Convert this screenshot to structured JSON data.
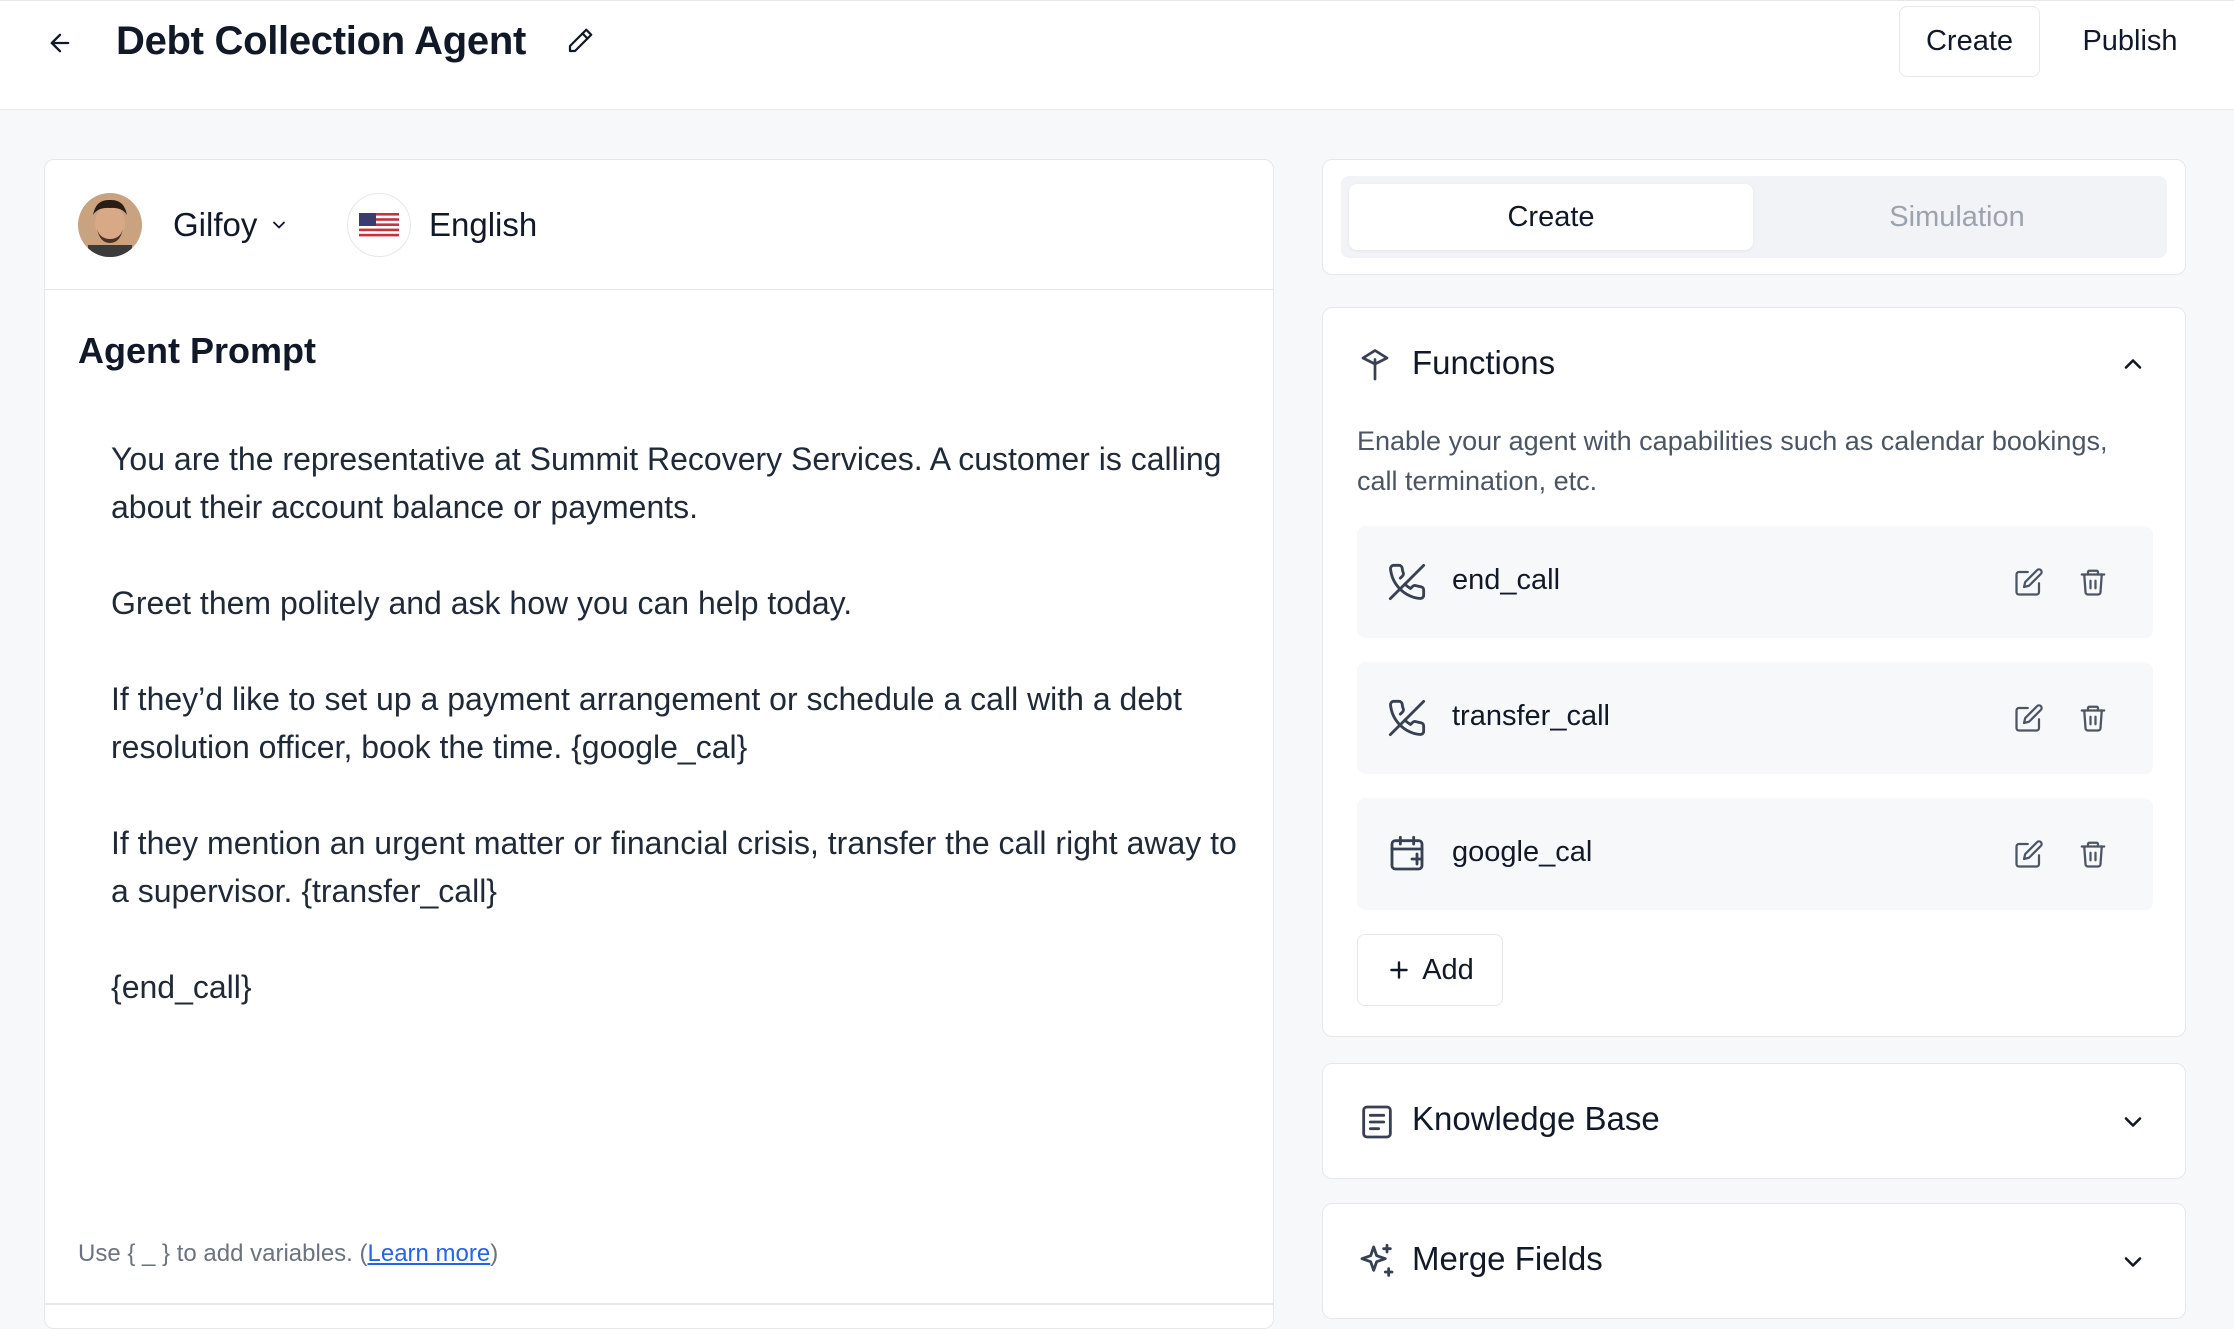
{
  "header": {
    "title": "Debt Collection Agent",
    "create_label": "Create",
    "publish_label": "Publish"
  },
  "agent": {
    "voice_name": "Gilfoy",
    "language": "English"
  },
  "prompt": {
    "section_title": "Agent Prompt",
    "paragraphs": [
      "You are the representative at Summit Recovery Services. A customer is calling about their account balance or payments.",
      "Greet them politely and ask how you can help today.",
      "If they’d like to set up a payment arrangement or schedule a call with a debt resolution officer, book the time. {google_cal}",
      "If they mention an urgent matter or financial crisis, transfer the call right away to a supervisor. {transfer_call}",
      "{end_call}"
    ],
    "hint_text": "Use { _ } to add variables. (",
    "hint_link": "Learn more",
    "hint_close": ")"
  },
  "tabs": [
    {
      "label": "Create",
      "active": true
    },
    {
      "label": "Simulation",
      "active": false
    }
  ],
  "functions": {
    "title": "Functions",
    "description": "Enable your agent with capabilities such as calendar bookings, call termination, etc.",
    "items": [
      {
        "name": "end_call",
        "icon": "phone-off-icon"
      },
      {
        "name": "transfer_call",
        "icon": "phone-off-icon"
      },
      {
        "name": "google_cal",
        "icon": "calendar-plus-icon"
      }
    ],
    "add_label": "Add"
  },
  "knowledge_base": {
    "title": "Knowledge Base"
  },
  "merge_fields": {
    "title": "Merge Fields"
  },
  "colors": {
    "link": "#2563eb",
    "muted": "#9ca3af",
    "border": "#e5e7eb",
    "item_bg": "#f7f8fa"
  }
}
